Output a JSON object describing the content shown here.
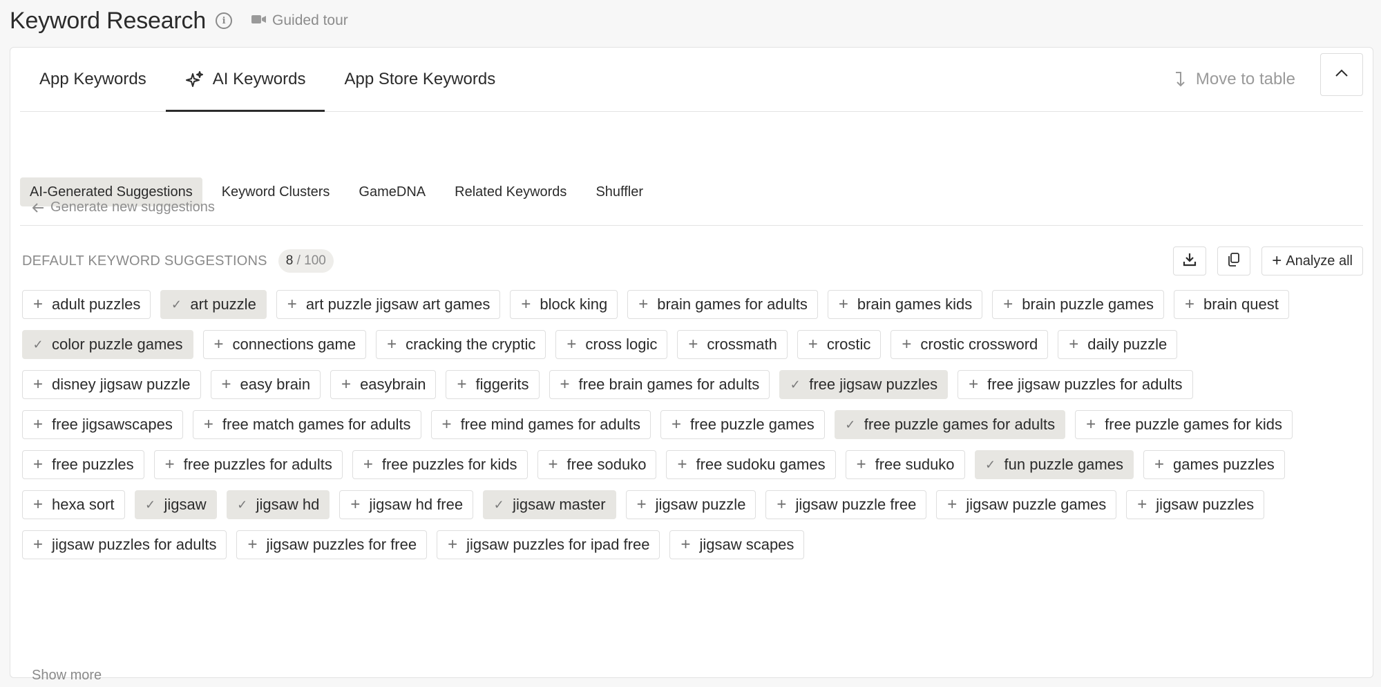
{
  "header": {
    "title": "Keyword Research",
    "guided_tour": "Guided tour"
  },
  "tabs": [
    {
      "label": "App Keywords",
      "active": false
    },
    {
      "label": "AI Keywords",
      "active": true
    },
    {
      "label": "App Store Keywords",
      "active": false
    }
  ],
  "move_to_table": "Move to table",
  "subtabs": [
    {
      "label": "AI-Generated Suggestions",
      "active": true
    },
    {
      "label": "Keyword Clusters",
      "active": false
    },
    {
      "label": "GameDNA",
      "active": false
    },
    {
      "label": "Related Keywords",
      "active": false
    },
    {
      "label": "Shuffler",
      "active": false
    }
  ],
  "generate_label": "Generate new suggestions",
  "section": {
    "title": "DEFAULT KEYWORD SUGGESTIONS",
    "count_selected": "8",
    "count_total": " / 100",
    "analyze_all": "Analyze all"
  },
  "keywords": [
    {
      "text": "adult puzzles",
      "selected": false
    },
    {
      "text": "art puzzle",
      "selected": true
    },
    {
      "text": "art puzzle jigsaw art games",
      "selected": false
    },
    {
      "text": "block king",
      "selected": false
    },
    {
      "text": "brain games for adults",
      "selected": false
    },
    {
      "text": "brain games kids",
      "selected": false
    },
    {
      "text": "brain puzzle games",
      "selected": false
    },
    {
      "text": "brain quest",
      "selected": false
    },
    {
      "text": "color puzzle games",
      "selected": true
    },
    {
      "text": "connections game",
      "selected": false
    },
    {
      "text": "cracking the cryptic",
      "selected": false
    },
    {
      "text": "cross logic",
      "selected": false
    },
    {
      "text": "crossmath",
      "selected": false
    },
    {
      "text": "crostic",
      "selected": false
    },
    {
      "text": "crostic crossword",
      "selected": false
    },
    {
      "text": "daily puzzle",
      "selected": false
    },
    {
      "text": "disney jigsaw puzzle",
      "selected": false
    },
    {
      "text": "easy brain",
      "selected": false
    },
    {
      "text": "easybrain",
      "selected": false
    },
    {
      "text": "figgerits",
      "selected": false
    },
    {
      "text": "free brain games for adults",
      "selected": false
    },
    {
      "text": "free jigsaw puzzles",
      "selected": true
    },
    {
      "text": "free jigsaw puzzles for adults",
      "selected": false
    },
    {
      "text": "free jigsawscapes",
      "selected": false
    },
    {
      "text": "free match games for adults",
      "selected": false
    },
    {
      "text": "free mind games for adults",
      "selected": false
    },
    {
      "text": "free puzzle games",
      "selected": false
    },
    {
      "text": "free puzzle games for adults",
      "selected": true
    },
    {
      "text": "free puzzle games for kids",
      "selected": false
    },
    {
      "text": "free puzzles",
      "selected": false
    },
    {
      "text": "free puzzles for adults",
      "selected": false
    },
    {
      "text": "free puzzles for kids",
      "selected": false
    },
    {
      "text": "free soduko",
      "selected": false
    },
    {
      "text": "free sudoku games",
      "selected": false
    },
    {
      "text": "free suduko",
      "selected": false
    },
    {
      "text": "fun puzzle games",
      "selected": true
    },
    {
      "text": "games puzzles",
      "selected": false
    },
    {
      "text": "hexa sort",
      "selected": false
    },
    {
      "text": "jigsaw",
      "selected": true
    },
    {
      "text": "jigsaw hd",
      "selected": true
    },
    {
      "text": "jigsaw hd free",
      "selected": false
    },
    {
      "text": "jigsaw master",
      "selected": true
    },
    {
      "text": "jigsaw puzzle",
      "selected": false
    },
    {
      "text": "jigsaw puzzle free",
      "selected": false
    },
    {
      "text": "jigsaw puzzle games",
      "selected": false
    },
    {
      "text": "jigsaw puzzles",
      "selected": false
    },
    {
      "text": "jigsaw puzzles for adults",
      "selected": false
    },
    {
      "text": "jigsaw puzzles for free",
      "selected": false
    },
    {
      "text": "jigsaw puzzles for ipad free",
      "selected": false
    },
    {
      "text": "jigsaw scapes",
      "selected": false
    }
  ],
  "show_more": "Show more",
  "icons": {
    "plus": "plus-icon",
    "check": "check-icon",
    "download": "download-icon",
    "copy": "copy-icon",
    "sparkle": "sparkle-icon",
    "video": "video-camera-icon"
  }
}
